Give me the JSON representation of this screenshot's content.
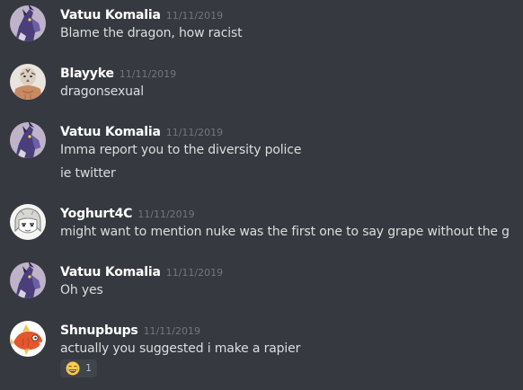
{
  "messages": [
    {
      "author": "Vatuu Komalia",
      "timestamp": "11/11/2019",
      "avatar": "purple-dragon-avatar",
      "lines": [
        "Blame the dragon, how racist"
      ]
    },
    {
      "author": "Blayyke",
      "timestamp": "11/11/2019",
      "avatar": "tiger-person-avatar",
      "lines": [
        "dragonsexual"
      ]
    },
    {
      "author": "Vatuu Komalia",
      "timestamp": "11/11/2019",
      "avatar": "purple-dragon-avatar",
      "lines": [
        "Imma report you to the diversity police",
        "ie twitter"
      ]
    },
    {
      "author": "Yoghurt4C",
      "timestamp": "11/11/2019",
      "avatar": "anime-sketch-avatar",
      "lines": [
        "might want to mention nuke was the first one to say grape without the g"
      ]
    },
    {
      "author": "Vatuu Komalia",
      "timestamp": "11/11/2019",
      "avatar": "purple-dragon-avatar",
      "lines": [
        "Oh yes"
      ]
    },
    {
      "author": "Shnupbups",
      "timestamp": "11/11/2019",
      "avatar": "magikarp-avatar",
      "lines": [
        "actually you suggested i make a rapier"
      ],
      "reaction": {
        "emoji": "joy-emoji",
        "count": "1"
      }
    }
  ],
  "colors": {
    "background": "#36393f",
    "username": "#ffffff",
    "message_text": "#dcddde",
    "timestamp": "#72767d",
    "reaction_bg": "#40444b"
  }
}
